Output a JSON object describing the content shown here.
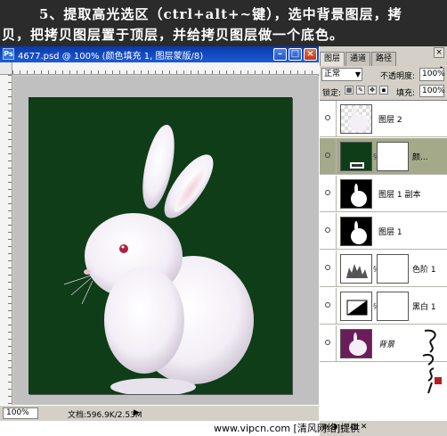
{
  "banner": {
    "line1": "5、提取高光选区（ctrl+alt+~键），选中背景图层，拷",
    "line2": "贝，把拷贝图层置于顶层，并给拷贝图层做一个底色。"
  },
  "document": {
    "title": "4677.psd @ 100% (颜色填充 1, 图层蒙版/8)",
    "zoom": "100%",
    "doc_info": "文档:596.9K/2.53M",
    "arrow": "▶"
  },
  "panel": {
    "tabs": [
      "图层",
      "通道",
      "路径"
    ],
    "close": "×",
    "menu": "▸",
    "blend_mode": "正常",
    "opacity_label": "不透明度:",
    "opacity_value": "100%",
    "lock_label": "锁定:",
    "fill_label": "填充:",
    "fill_value": "100%",
    "footer_icons": "⊕ ◑ ▭ ▤ ✕"
  },
  "layers": [
    {
      "name": "图层 2",
      "thumb": "rabbit",
      "selected": false
    },
    {
      "name": "颜...",
      "thumb": "fill-mask",
      "selected": true
    },
    {
      "name": "图层 1 副本",
      "thumb": "mask-rabbit",
      "selected": false
    },
    {
      "name": "图层 1",
      "thumb": "mask-rabbit",
      "selected": false
    },
    {
      "name": "色阶 1",
      "thumb": "levels",
      "selected": false
    },
    {
      "name": "黑白 1",
      "thumb": "bw",
      "selected": false
    },
    {
      "name": "背景",
      "thumb": "bg-rabbit",
      "selected": false
    }
  ],
  "footer_text": "www.vipcn.com [清风网络]提供",
  "colors": {
    "canvas_bg": "#0e3d18",
    "selected_layer": "#a4a98a",
    "titlebar": "#1d5ad8"
  }
}
